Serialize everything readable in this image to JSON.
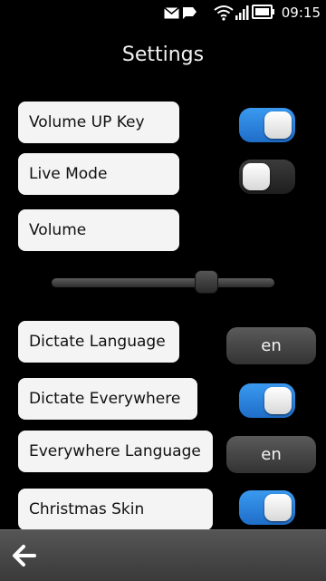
{
  "status_bar": {
    "time": "09:15",
    "icons": [
      "mail-icon",
      "notification-icon",
      "wifi-icon",
      "signal-icon",
      "battery-icon"
    ]
  },
  "header": {
    "title": "Settings"
  },
  "settings": {
    "volume_up_key": {
      "label": "Volume UP Key",
      "enabled": true
    },
    "live_mode": {
      "label": "Live Mode",
      "enabled": false
    },
    "volume": {
      "label": "Volume",
      "level": 0.72
    },
    "dictate_language": {
      "label": "Dictate Language",
      "value": "en"
    },
    "dictate_everywhere": {
      "label": "Dictate Everywhere",
      "enabled": true
    },
    "everywhere_language": {
      "label": "Everywhere Language",
      "value": "en"
    },
    "christmas_skin": {
      "label": "Christmas Skin",
      "enabled": true
    }
  },
  "colors": {
    "toggle_on": "#2a82e0",
    "toggle_off": "#2b2b2b",
    "toolbar": "#474747"
  },
  "toolbar": {
    "back_icon": "back-arrow-icon"
  }
}
